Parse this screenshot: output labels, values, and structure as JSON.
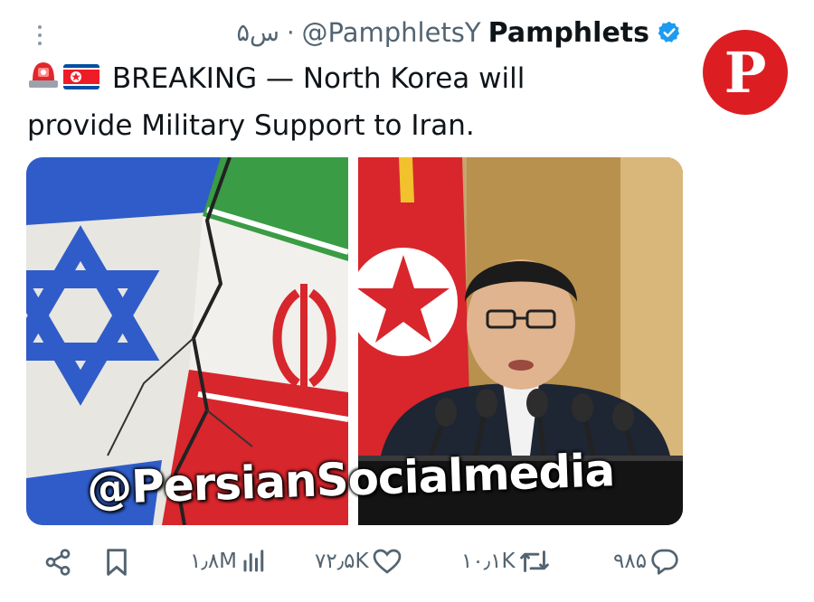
{
  "author": {
    "name": "Pamphlets",
    "handle": "@PamphletsY",
    "time": "۵س",
    "separator": "·",
    "avatar_letter": "P",
    "avatar_color": "#dc1e23",
    "verified_color": "#1d9bf0"
  },
  "tweet": {
    "line1": "BREAKING — North Korea will",
    "line2": "provide Military Support to Iran.",
    "emojis": [
      "siren-emoji",
      "north-korea-flag-emoji"
    ]
  },
  "media": {
    "watermark": "@PersianSocialmedia",
    "left_image": "israel-iran-cracked-flags",
    "right_image": "speaker-at-podium-with-north-korean-flag"
  },
  "actions": {
    "share_icon": "share-icon",
    "bookmark_icon": "bookmark-icon",
    "views": "۱٫۸M",
    "likes": "۷۲٫۵K",
    "retweets": "۱۰٫۱K",
    "replies": "۹۸۵"
  },
  "colors": {
    "text": "#0f1419",
    "muted": "#536471",
    "action": "#536471"
  }
}
